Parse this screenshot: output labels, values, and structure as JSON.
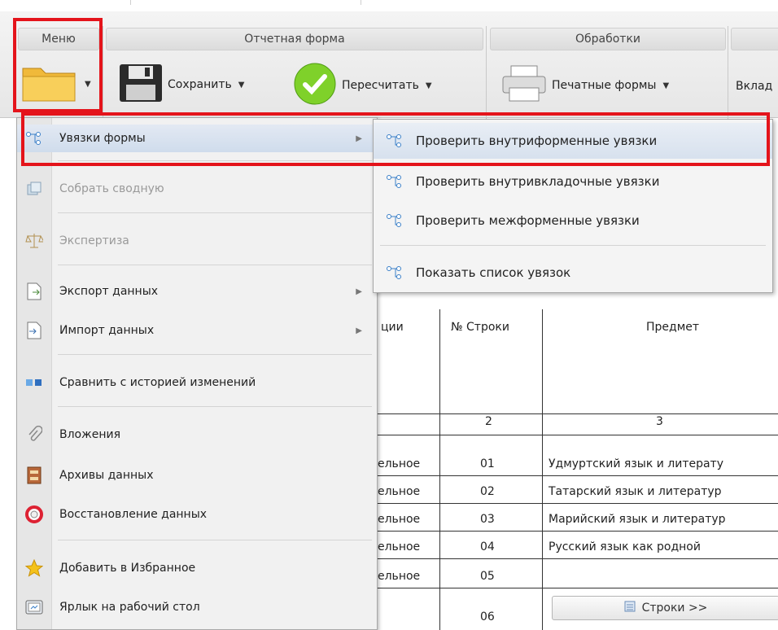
{
  "ribbon": {
    "groups": [
      "Меню",
      "Отчетная форма",
      "Обработки"
    ],
    "save_label": "Сохранить",
    "recalc_label": "Пересчитать",
    "print_label": "Печатные формы",
    "tab_partial": "Вклад"
  },
  "menu": {
    "items": [
      {
        "label": "Увязки формы",
        "icon": "links-icon"
      },
      {
        "label": "Собрать сводную",
        "icon": "collect-icon"
      },
      {
        "label": "Экспертиза",
        "icon": "scales-icon"
      },
      {
        "label": "Экспорт данных",
        "icon": "export-icon"
      },
      {
        "label": "Импорт данных",
        "icon": "import-icon"
      },
      {
        "label": "Сравнить с историей изменений",
        "icon": "compare-icon"
      },
      {
        "label": "Вложения",
        "icon": "paperclip-icon"
      },
      {
        "label": "Архивы данных",
        "icon": "archive-icon"
      },
      {
        "label": "Восстановление данных",
        "icon": "lifebuoy-icon"
      },
      {
        "label": "Добавить в Избранное",
        "icon": "star-icon"
      },
      {
        "label": "Ярлык на рабочий стол",
        "icon": "shortcut-icon"
      }
    ]
  },
  "submenu": {
    "items": [
      {
        "label": "Проверить внутриформенные увязки"
      },
      {
        "label": "Проверить внутривкладочные увязки"
      },
      {
        "label": "Проверить межформенные увязки"
      },
      {
        "label": "Показать список увязок"
      }
    ]
  },
  "table": {
    "headers": [
      "ции",
      "№ Строки",
      "Предмет"
    ],
    "col_numbers": [
      "2",
      "3"
    ],
    "rows": [
      {
        "c1": "ельное",
        "num": "01",
        "subject": "Удмуртский язык и литерату"
      },
      {
        "c1": "ельное",
        "num": "02",
        "subject": "Татарский язык и литератур"
      },
      {
        "c1": "ельное",
        "num": "03",
        "subject": "Марийский язык и литератур"
      },
      {
        "c1": "ельное",
        "num": "04",
        "subject": "Русский язык как родной"
      },
      {
        "c1": "ельное",
        "num": "05",
        "subject": ""
      },
      {
        "c1": "",
        "num": "06",
        "subject": ""
      }
    ],
    "rows_button": "Строки >>"
  },
  "colors": {
    "highlight": "#e4141b",
    "menu_bg": "#f1f1f1",
    "hover": "#cfdcec"
  }
}
